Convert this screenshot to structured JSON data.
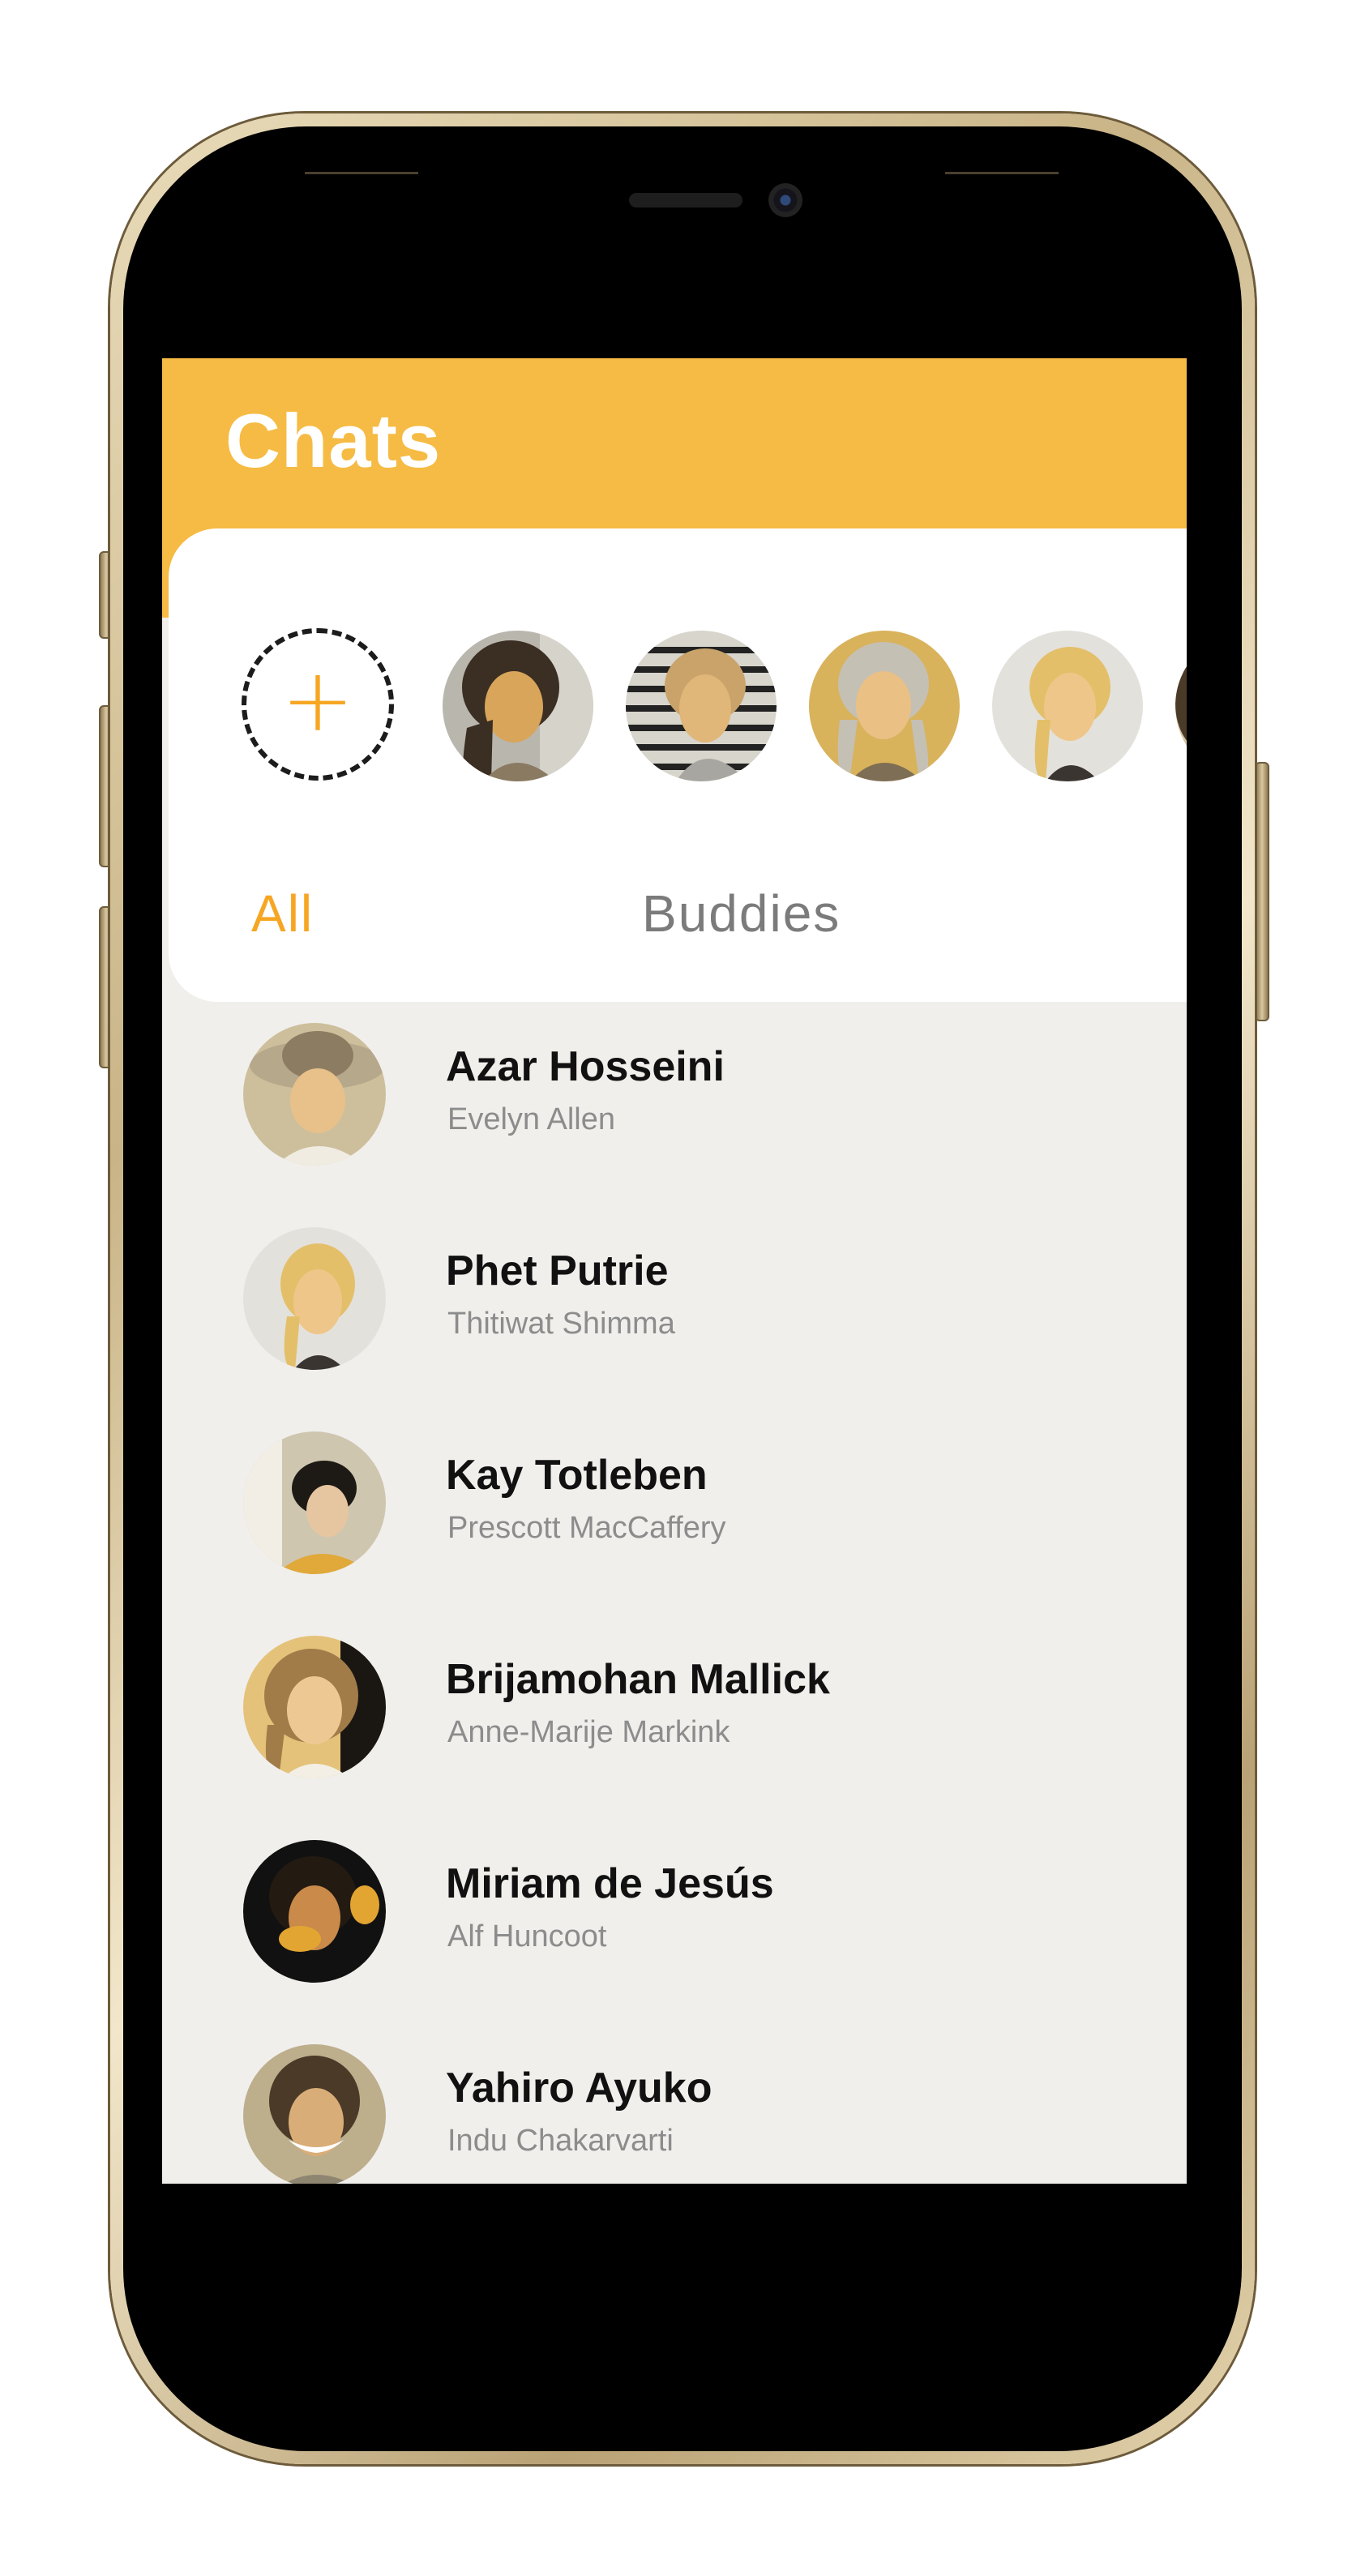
{
  "header": {
    "title": "Chats"
  },
  "stories": {
    "add_icon": "plus-icon",
    "items": [
      {
        "avatar": "avatar-photo"
      },
      {
        "avatar": "avatar-photo"
      },
      {
        "avatar": "avatar-photo"
      },
      {
        "avatar": "avatar-photo"
      }
    ]
  },
  "tabs": [
    {
      "label": "All",
      "active": true
    },
    {
      "label": "Buddies",
      "active": false
    }
  ],
  "chats": [
    {
      "name": "Azar Hosseini",
      "subtitle": "Evelyn Allen"
    },
    {
      "name": "Phet Putrie",
      "subtitle": "Thitiwat Shimma"
    },
    {
      "name": "Kay Totleben",
      "subtitle": "Prescott MacCaffery"
    },
    {
      "name": "Brijamohan Mallick",
      "subtitle": "Anne-Marije Markink"
    },
    {
      "name": "Miriam de Jesús",
      "subtitle": "Alf Huncoot"
    },
    {
      "name": "Yahiro Ayuko",
      "subtitle": "Indu Chakarvarti"
    }
  ],
  "colors": {
    "accent": "#f6bb44",
    "tab_active": "#f6a623",
    "tab_inactive": "#7b7b7b",
    "list_background": "#f0efec",
    "phone_frame": "#c9b487"
  }
}
